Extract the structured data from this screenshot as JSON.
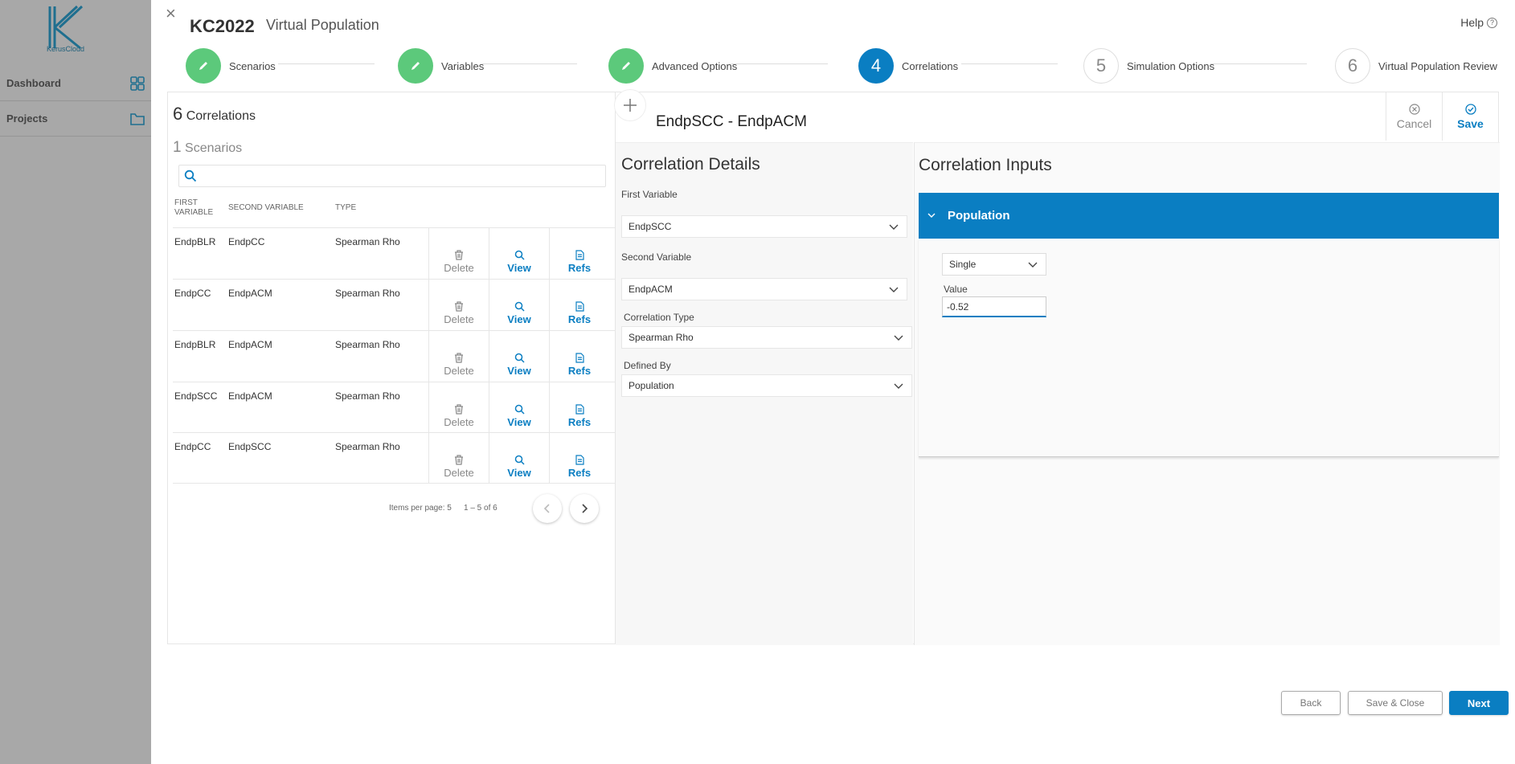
{
  "sidebar": {
    "logo_text": "KerusCloud",
    "items": [
      {
        "label": "Dashboard",
        "icon": "grid-icon"
      },
      {
        "label": "Projects",
        "icon": "folder-icon"
      }
    ]
  },
  "header": {
    "app_title": "KC2022",
    "subtitle": "Virtual Population",
    "help_label": "Help",
    "help_icon": "?"
  },
  "stepper": {
    "steps": [
      {
        "number": "",
        "label": "Scenarios",
        "state": "done"
      },
      {
        "number": "",
        "label": "Variables",
        "state": "done"
      },
      {
        "number": "",
        "label": "Advanced Options",
        "state": "done"
      },
      {
        "number": "4",
        "label": "Correlations",
        "state": "active"
      },
      {
        "number": "5",
        "label": "Simulation Options",
        "state": "todo"
      },
      {
        "number": "6",
        "label": "Virtual Population Review",
        "state": "todo"
      }
    ]
  },
  "list": {
    "count": "6",
    "count_label": "Correlations",
    "scenario_count": "1",
    "scenario_label": "Scenarios",
    "search_placeholder": "",
    "columns": [
      "FIRST VARIABLE",
      "SECOND VARIABLE",
      "TYPE"
    ],
    "rows": [
      {
        "first": "EndpBLR",
        "second": "EndpCC",
        "type": "Spearman Rho"
      },
      {
        "first": "EndpCC",
        "second": "EndpACM",
        "type": "Spearman Rho"
      },
      {
        "first": "EndpBLR",
        "second": "EndpACM",
        "type": "Spearman Rho"
      },
      {
        "first": "EndpSCC",
        "second": "EndpACM",
        "type": "Spearman Rho"
      },
      {
        "first": "EndpCC",
        "second": "EndpSCC",
        "type": "Spearman Rho"
      }
    ],
    "actions": {
      "delete": "Delete",
      "view": "View",
      "refs": "Refs"
    },
    "pager": {
      "items_per_page": "Items per page: 5",
      "range": "1 – 5 of 6"
    }
  },
  "detail": {
    "title": "EndpSCC - EndpACM",
    "cancel_label": "Cancel",
    "save_label": "Save",
    "details_title": "Correlation Details",
    "first_variable_label": "First Variable",
    "first_variable_value": "EndpSCC",
    "second_variable_label": "Second Variable",
    "second_variable_value": "EndpACM",
    "correlation_type_label": "Correlation Type",
    "correlation_type_value": "Spearman Rho",
    "defined_by_label": "Defined By",
    "defined_by_value": "Population",
    "inputs_title": "Correlation Inputs",
    "population_label": "Population",
    "mode_value": "Single",
    "value_label": "Value",
    "value": "-0.52"
  },
  "footer": {
    "back_label": "Back",
    "save_close_label": "Save & Close",
    "next_label": "Next"
  },
  "colors": {
    "accent": "#0a7ec2",
    "done": "#5cc97b"
  }
}
